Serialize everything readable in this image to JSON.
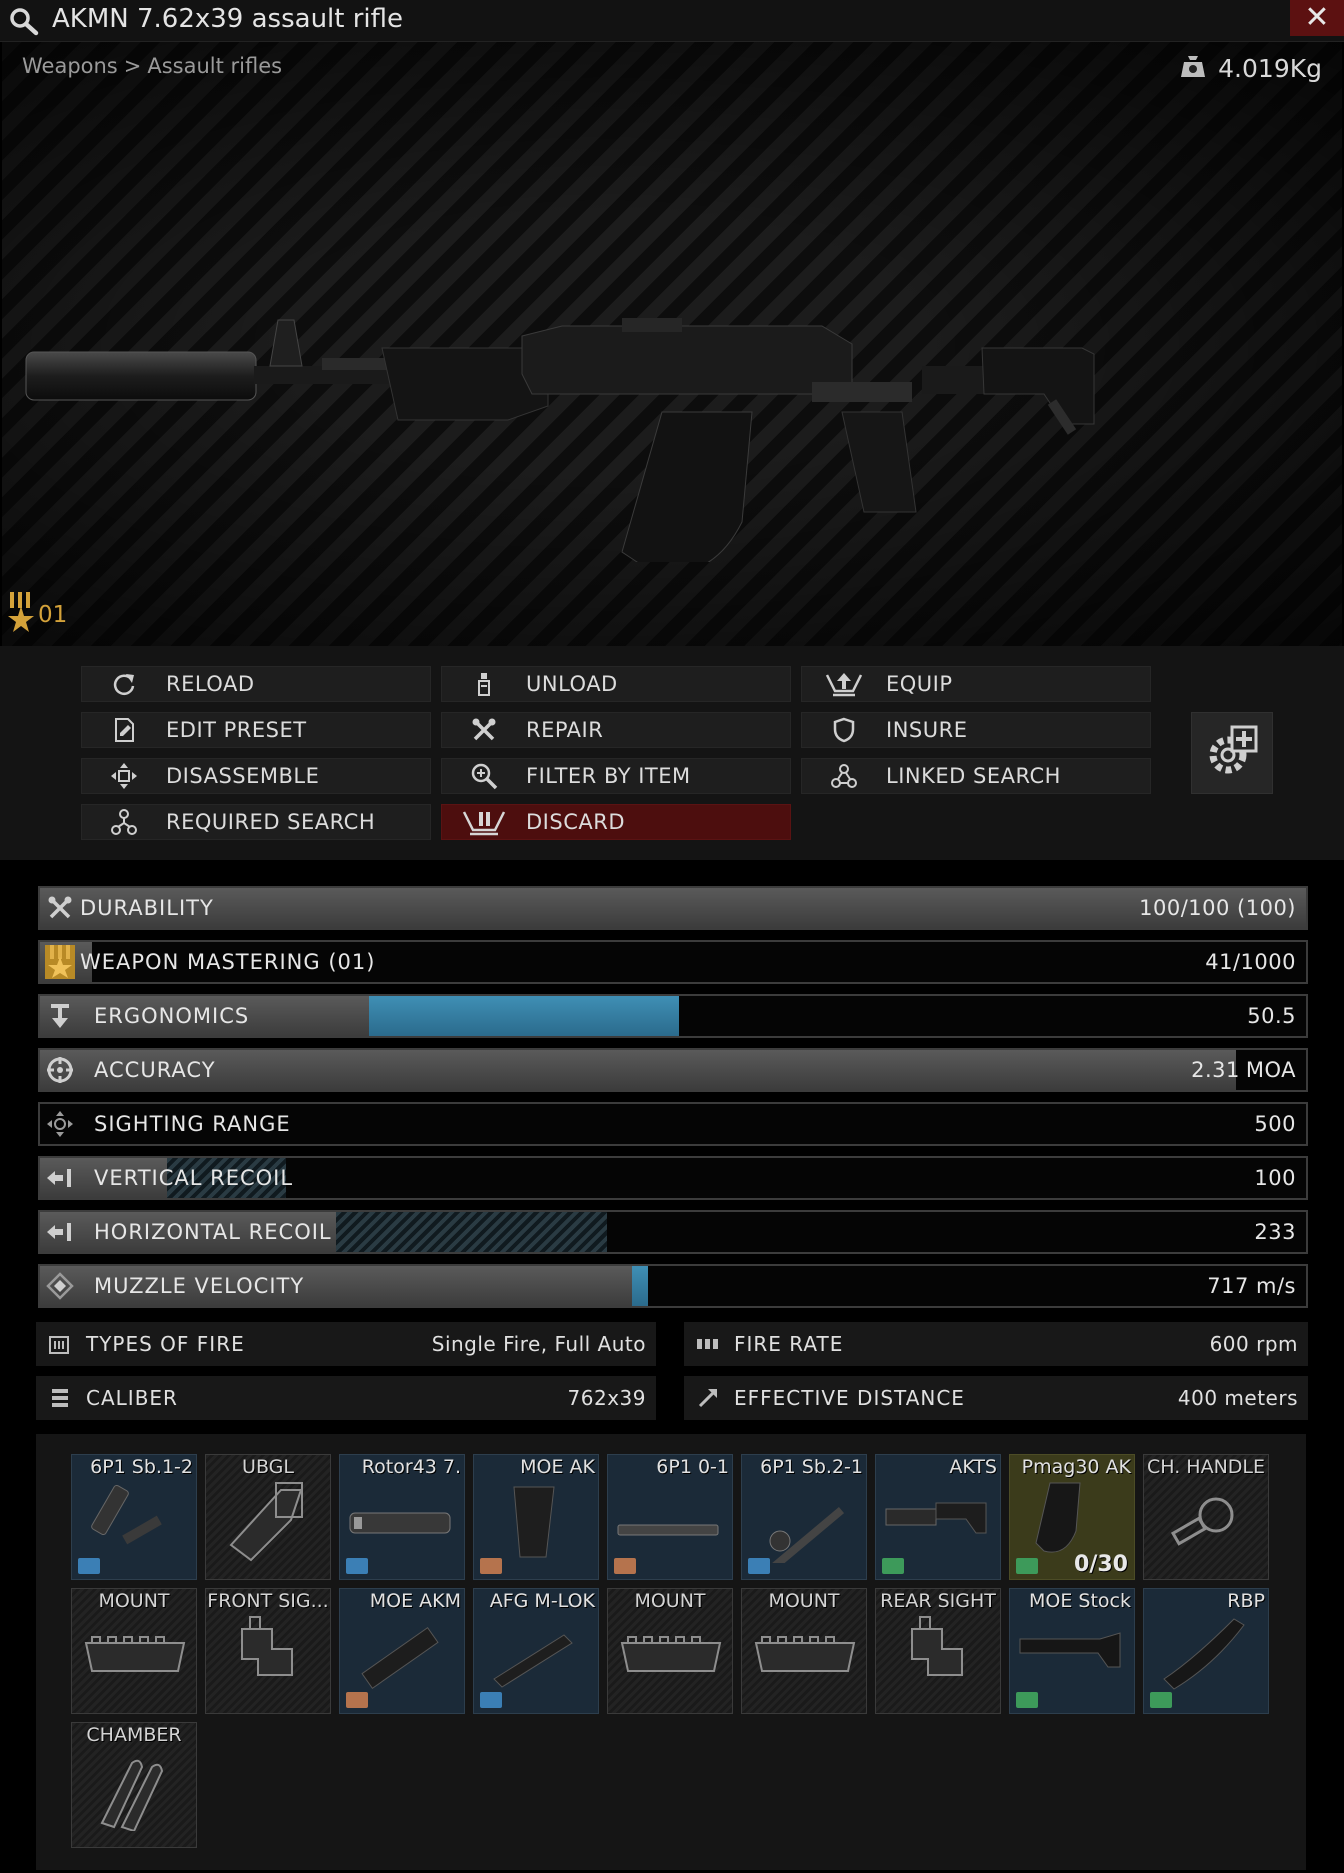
{
  "window": {
    "title": "AKMN 7.62x39 assault rifle",
    "close_glyph": "✕",
    "icons": [
      "search-icon",
      "close-icon"
    ]
  },
  "preview": {
    "breadcrumb": [
      "Weapons",
      "Assault rifles"
    ],
    "breadcrumb_separator": ">",
    "weight": "4.019Kg",
    "mastery_level": "01",
    "mastery_color": "#d4a23a"
  },
  "actions": [
    {
      "label": "RELOAD",
      "icon": "reload-icon"
    },
    {
      "label": "UNLOAD",
      "icon": "unload-icon"
    },
    {
      "label": "EQUIP",
      "icon": "equip-icon"
    },
    {
      "label": "EDIT PRESET",
      "icon": "edit-preset-icon"
    },
    {
      "label": "REPAIR",
      "icon": "repair-icon"
    },
    {
      "label": "INSURE",
      "icon": "shield-icon"
    },
    {
      "label": "DISASSEMBLE",
      "icon": "disassemble-icon"
    },
    {
      "label": "FILTER BY ITEM",
      "icon": "filter-search-icon"
    },
    {
      "label": "LINKED SEARCH",
      "icon": "linked-search-icon"
    },
    {
      "label": "REQUIRED SEARCH",
      "icon": "required-search-icon"
    },
    {
      "label": "DISCARD",
      "icon": "discard-icon",
      "danger": true
    }
  ],
  "stats": [
    {
      "label": "DURABILITY",
      "value": "100/100 (100)",
      "fill": 1.0,
      "icon": "repair-icon"
    },
    {
      "label": "WEAPON MASTERING (01)",
      "value": "41/1000",
      "fill": 0.041,
      "icon": "mastery-icon"
    },
    {
      "label": "ERGONOMICS",
      "value": "50.5",
      "fill": 0.26,
      "delta_blue": 0.245,
      "icon": "ergonomics-icon"
    },
    {
      "label": "ACCURACY",
      "value": "2.31",
      "unit": "MOA",
      "fill": 0.945,
      "icon": "crosshair-icon"
    },
    {
      "label": "SIGHTING RANGE",
      "value": "500",
      "fill": 0.0,
      "icon": "sighting-icon"
    },
    {
      "label": "VERTICAL RECOIL",
      "value": "100",
      "fill": 0.1,
      "delta_hatch": 0.094,
      "icon": "recoil-icon"
    },
    {
      "label": "HORIZONTAL RECOIL",
      "value": "233",
      "fill": 0.234,
      "delta_hatch": 0.214,
      "icon": "recoil-icon"
    },
    {
      "label": "MUZZLE VELOCITY",
      "value": "717 m/s",
      "fill": 0.468,
      "delta_blue": 0.012,
      "icon": "velocity-icon"
    }
  ],
  "info": [
    {
      "label": "TYPES OF FIRE",
      "value": "Single Fire, Full Auto",
      "icon": "fire-types-icon"
    },
    {
      "label": "FIRE RATE",
      "value": "600 rpm",
      "icon": "fire-rate-icon"
    },
    {
      "label": "CALIBER",
      "value": "762x39",
      "icon": "caliber-icon"
    },
    {
      "label": "EFFECTIVE DISTANCE",
      "value": "400 meters",
      "icon": "distance-icon"
    }
  ],
  "slots": [
    {
      "name": "6P1 Sb.1-2",
      "state": "filled",
      "art": "gasblock",
      "cat": "#3b7fb5"
    },
    {
      "name": "UBGL",
      "state": "empty",
      "art": "launcher"
    },
    {
      "name": "Rotor43 7.",
      "state": "filled",
      "art": "muzzle",
      "cat": "#3b7fb5"
    },
    {
      "name": "MOE AK",
      "state": "filled",
      "art": "grip",
      "cat": "#b5734d"
    },
    {
      "name": "6P1 0-1",
      "state": "filled",
      "art": "dustcover",
      "cat": "#b5734d"
    },
    {
      "name": "6P1 Sb.2-1",
      "state": "filled",
      "art": "barrel",
      "cat": "#3b7fb5"
    },
    {
      "name": "AKTS",
      "state": "filled",
      "art": "buffer",
      "cat": "#3d9a5a"
    },
    {
      "name": "Pmag30 AK",
      "state": "filled-mag",
      "art": "magazine",
      "cat": "#3d9a5a",
      "count": "0/30"
    },
    {
      "name": "CH. HANDLE",
      "state": "empty",
      "art": "chandle"
    },
    {
      "name": "MOUNT",
      "state": "empty",
      "art": "mount"
    },
    {
      "name": "FRONT SIG...",
      "state": "empty",
      "art": "sight"
    },
    {
      "name": "MOE AKM",
      "state": "filled",
      "art": "handguard",
      "cat": "#b5734d"
    },
    {
      "name": "AFG M-LOK",
      "state": "filled",
      "art": "foregrip",
      "cat": "#3b7fb5"
    },
    {
      "name": "MOUNT",
      "state": "empty",
      "art": "mount"
    },
    {
      "name": "MOUNT",
      "state": "empty",
      "art": "mount"
    },
    {
      "name": "REAR SIGHT",
      "state": "empty",
      "art": "sight"
    },
    {
      "name": "MOE Stock",
      "state": "filled",
      "art": "stock",
      "cat": "#3d9a5a"
    },
    {
      "name": "RBP",
      "state": "filled",
      "art": "buttpad",
      "cat": "#3d9a5a"
    },
    {
      "name": "CHAMBER",
      "state": "empty",
      "art": "chamber"
    }
  ]
}
